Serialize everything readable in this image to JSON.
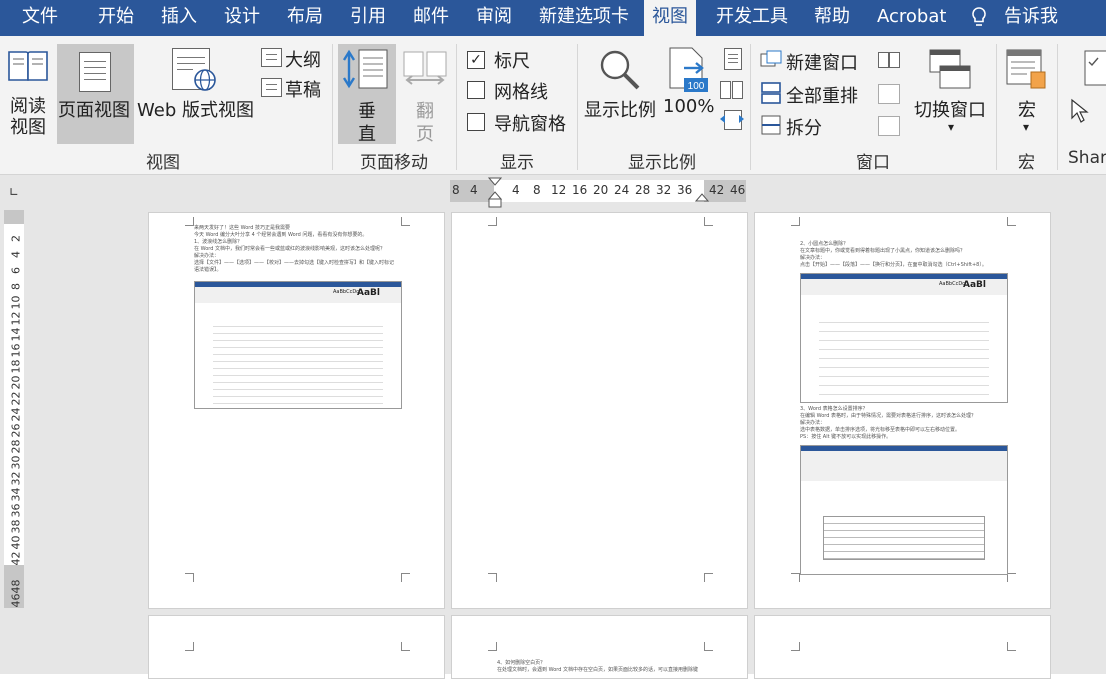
{
  "tabs": [
    {
      "label": "文件"
    },
    {
      "label": "开始"
    },
    {
      "label": "插入"
    },
    {
      "label": "设计"
    },
    {
      "label": "布局"
    },
    {
      "label": "引用"
    },
    {
      "label": "邮件"
    },
    {
      "label": "审阅"
    },
    {
      "label": "新建选项卡"
    },
    {
      "label": "视图"
    },
    {
      "label": "开发工具"
    },
    {
      "label": "帮助"
    },
    {
      "label": "Acrobat"
    },
    {
      "label": "告诉我"
    }
  ],
  "ribbon": {
    "views": {
      "read_mode": "阅读\n视图",
      "print_layout": "页面视图",
      "web_layout": "Web 版式视图",
      "outline": "大纲",
      "draft": "草稿",
      "group": "视图"
    },
    "page_movement": {
      "vertical_top": "垂",
      "vertical_bottom": "直",
      "side_top": "翻",
      "side_bottom": "页",
      "group": "页面移动"
    },
    "show": {
      "ruler": "标尺",
      "gridlines": "网格线",
      "nav_pane": "导航窗格",
      "ruler_checked": true,
      "gridlines_checked": false,
      "nav_checked": false,
      "group": "显示"
    },
    "zoom": {
      "zoom": "显示比例",
      "hundred": "100%",
      "hundred_icon": "100",
      "group": "显示比例"
    },
    "window": {
      "new_window": "新建窗口",
      "arrange_all": "全部重排",
      "split": "拆分",
      "switch_windows": "切换窗口",
      "group": "窗口"
    },
    "macros": {
      "macros": "宏",
      "group": "宏"
    },
    "share": {
      "group": "Shar"
    }
  },
  "hruler_ticks": [
    "8",
    "4",
    "4",
    "8",
    "12",
    "16",
    "20",
    "24",
    "28",
    "32",
    "36",
    "42",
    "46"
  ],
  "vruler_ticks": [
    "2",
    "4",
    "6",
    "8",
    "10",
    "12",
    "14",
    "16",
    "18",
    "20",
    "22",
    "24",
    "26",
    "28",
    "30",
    "32",
    "34",
    "36",
    "38",
    "40",
    "42",
    "48",
    "46"
  ],
  "pages": {
    "p1_lines": [
      "来两天发好了！这些 Word 技巧正是我需要",
      "今天 Word 编分大叶分享 4 个经常会遇到 Word 问题，看看有没有你想要的。",
      "1、波浪线怎么删除？",
      "在 Word 文档中，我们时常会看一些或蓝或红的波浪线影响美观，这时该怎么处理呢？",
      "解决办法：",
      "选择【文件】——【选项】——【校对】——去掉勾选【键入时检查拼写】和【键入时标记",
      "语法错误】。"
    ],
    "p3_lines": [
      "2、小圆点怎么删除？",
      "在文章标题中，你或觉看到得着标题出现了小黑点，你知道该怎么删除吗？",
      "解决办法：",
      "点击【开始】——【段落】——【换行和分页】，在面中取消勾选（Ctrl+Shift+8）。"
    ],
    "p3_lines2": [
      "3、Word 表格怎么设置排序？",
      "在编辑 Word 表格时，由于特殊情况，需要对表格进行排序，这时该怎么处理？",
      "解决办法：",
      "选中表格数据，单击排序选项，将光标移至表格中即可以左右移动位置。",
      "PS：按住 Alt 键不放可以实现此移操作。"
    ],
    "p8_lines": [
      "4、如何删除空白页？",
      "在处理文档时，会遇到 Word 文档中存在空白页，如果页面比较多的话，可以直接用删除键"
    ],
    "aabbcc": "AaBbCcDc",
    "aabb": "AaBl"
  }
}
